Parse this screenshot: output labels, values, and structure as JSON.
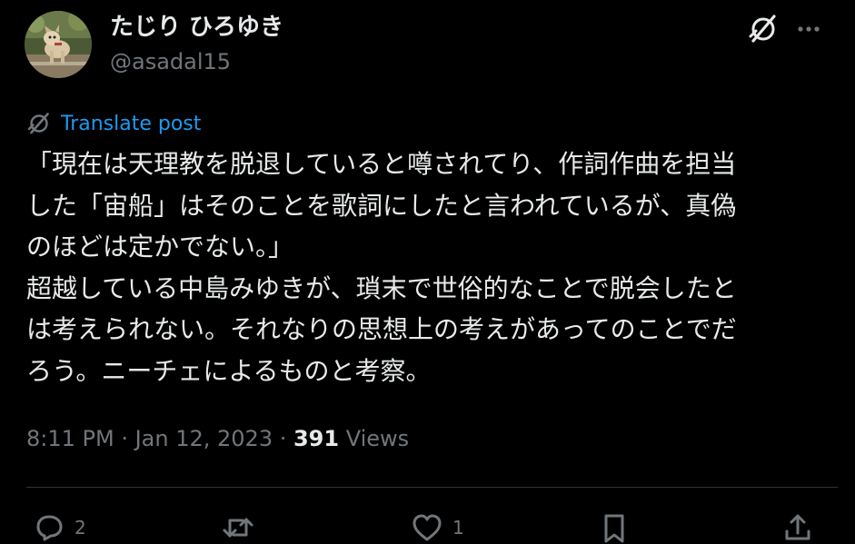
{
  "user": {
    "display_name": "たじり ひろゆき",
    "handle": "@asadal15"
  },
  "translate": {
    "label": "Translate post"
  },
  "post": {
    "text": "「現在は天理教を脱退していると噂されてり、作詞作曲を担当\nした「宙船」はそのことを歌詞にしたと言われているが、真偽\nのほどは定かでない。」\n超越している中島みゆきが、瑣末で世俗的なことで脱会したと\nは考えられない。それなりの思想上の考えがあってのことでだ\nろう。ニーチェによるものと考察。"
  },
  "meta": {
    "time": "8:11 PM",
    "sep1": " · ",
    "date": "Jan 12, 2023",
    "sep2": " · ",
    "views_count": "391",
    "views_label": " Views"
  },
  "actions": {
    "reply_count": "2",
    "like_count": "1"
  },
  "icons": {
    "grok": "grok-icon",
    "more": "more-icon",
    "translate": "grok-icon",
    "reply": "reply-icon",
    "retweet": "retweet-icon",
    "like": "heart-icon",
    "bookmark": "bookmark-icon",
    "share": "share-icon"
  },
  "colors": {
    "background": "#000000",
    "text_primary": "#e7e9ea",
    "text_secondary": "#71767b",
    "link": "#1d9bf0",
    "divider": "#2f3336"
  }
}
